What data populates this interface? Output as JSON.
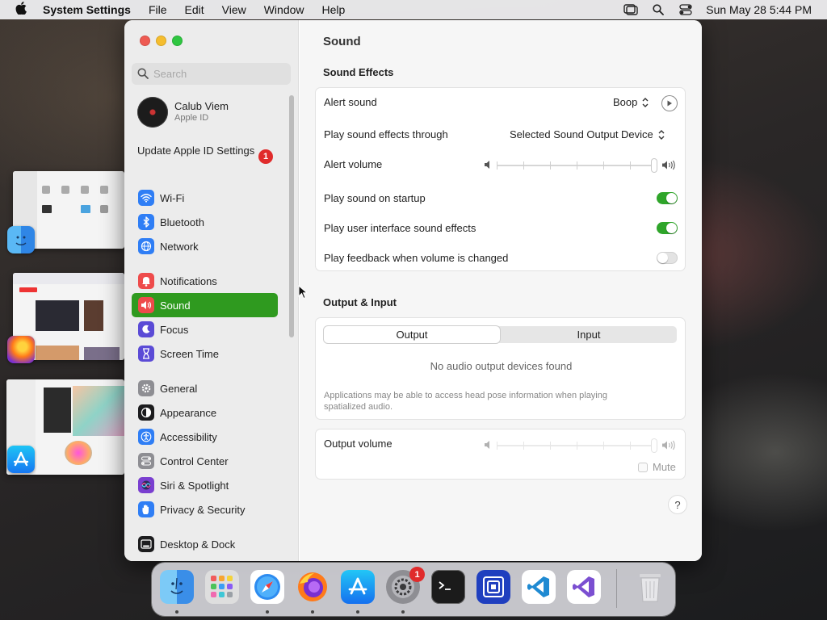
{
  "menubar": {
    "app_name": "System Settings",
    "menus": [
      "File",
      "Edit",
      "View",
      "Window",
      "Help"
    ],
    "clock": "Sun May 28  5:44 PM",
    "icons": [
      "apple-icon",
      "stage-manager-icon",
      "spotlight-icon",
      "control-center-icon"
    ]
  },
  "search": {
    "placeholder": "Search"
  },
  "account": {
    "name": "Calub Viem",
    "subtitle": "Apple ID"
  },
  "update": {
    "label": "Update Apple ID Settings",
    "badge": "1"
  },
  "sidebar": {
    "items": [
      {
        "label": "Wi-Fi",
        "color": "#2f7ef5",
        "icon": "wifi-icon"
      },
      {
        "label": "Bluetooth",
        "color": "#2f7ef5",
        "icon": "bluetooth-icon"
      },
      {
        "label": "Network",
        "color": "#2f7ef5",
        "icon": "globe-icon"
      },
      {
        "label": "Notifications",
        "color": "#ee4b4b",
        "icon": "bell-icon"
      },
      {
        "label": "Sound",
        "color": "#ee4b4b",
        "icon": "speaker-icon",
        "selected": true
      },
      {
        "label": "Focus",
        "color": "#5b4bd6",
        "icon": "moon-icon"
      },
      {
        "label": "Screen Time",
        "color": "#5b4bd6",
        "icon": "hourglass-icon"
      },
      {
        "label": "General",
        "color": "#8e8e93",
        "icon": "gear-icon"
      },
      {
        "label": "Appearance",
        "color": "#1c1c1e",
        "icon": "appearance-icon"
      },
      {
        "label": "Accessibility",
        "color": "#2f7ef5",
        "icon": "accessibility-icon"
      },
      {
        "label": "Control Center",
        "color": "#8e8e93",
        "icon": "control-center-icon"
      },
      {
        "label": "Siri & Spotlight",
        "color": "#7a3fd0",
        "icon": "siri-icon"
      },
      {
        "label": "Privacy & Security",
        "color": "#2f7ef5",
        "icon": "hand-icon"
      },
      {
        "label": "Desktop & Dock",
        "color": "#1c1c1e",
        "icon": "dock-icon"
      }
    ]
  },
  "content": {
    "title": "Sound",
    "sound_effects": {
      "heading": "Sound Effects",
      "alert_sound": {
        "label": "Alert sound",
        "value": "Boop"
      },
      "play_through": {
        "label": "Play sound effects through",
        "value": "Selected Sound Output Device"
      },
      "alert_volume": {
        "label": "Alert volume",
        "level": 1.0
      },
      "startup": {
        "label": "Play sound on startup",
        "on": true
      },
      "ui_effects": {
        "label": "Play user interface sound effects",
        "on": true
      },
      "feedback": {
        "label": "Play feedback when volume is changed",
        "on": false
      }
    },
    "output_input": {
      "heading": "Output & Input",
      "tabs": [
        "Output",
        "Input"
      ],
      "selected_tab": "Output",
      "empty_message": "No audio output devices found",
      "note": "Applications may be able to access head pose information when playing spatialized audio."
    },
    "output_volume": {
      "label": "Output volume",
      "level": 1.0,
      "mute_label": "Mute",
      "muted": false
    },
    "help": "?"
  },
  "dock": {
    "apps": [
      "Finder",
      "Launchpad",
      "Safari",
      "Firefox",
      "App Store",
      "System Settings",
      "Terminal",
      "Simulator",
      "Visual Studio Code",
      "Visual Studio"
    ],
    "system_settings_badge": "1"
  }
}
